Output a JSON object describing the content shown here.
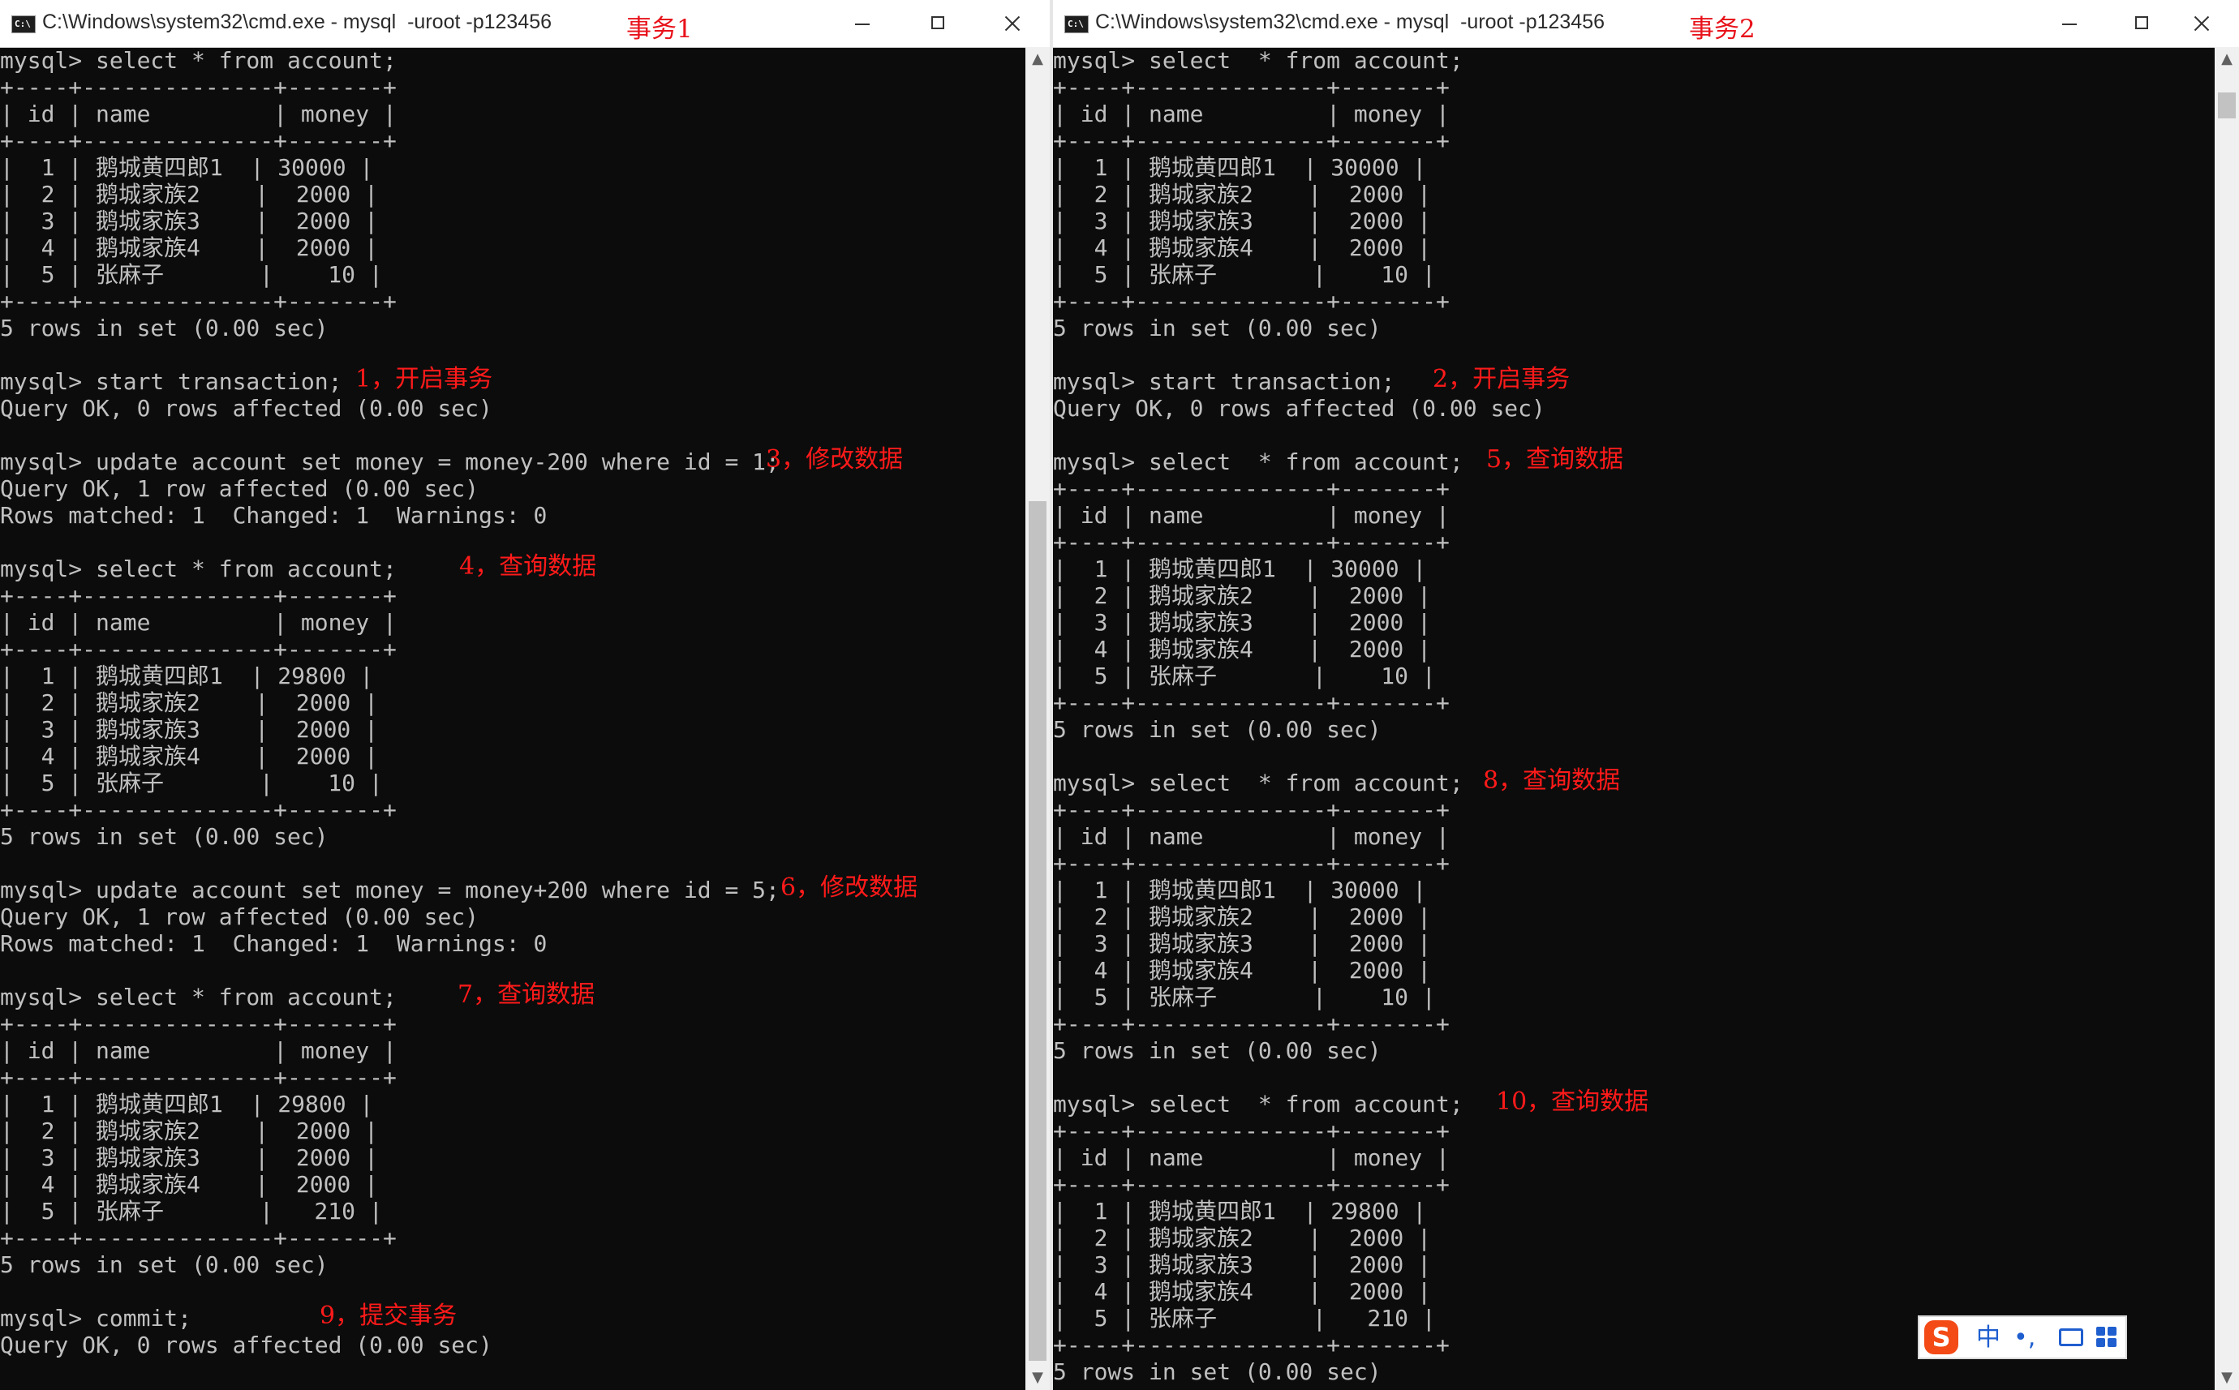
{
  "window1": {
    "title": "C:\\Windows\\system32\\cmd.exe - mysql  -uroot -p123456",
    "label": "事务1",
    "lines": [
      "mysql> select * from account;",
      "+----+--------------+-------+",
      "| id | name         | money |",
      "+----+--------------+-------+",
      "|  1 | 鹅城黄四郎1  | 30000 |",
      "|  2 | 鹅城家族2    |  2000 |",
      "|  3 | 鹅城家族3    |  2000 |",
      "|  4 | 鹅城家族4    |  2000 |",
      "|  5 | 张麻子       |    10 |",
      "+----+--------------+-------+",
      "5 rows in set (0.00 sec)",
      "",
      "mysql> start transaction;",
      "Query OK, 0 rows affected (0.00 sec)",
      "",
      "mysql> update account set money = money-200 where id = 1;",
      "Query OK, 1 row affected (0.00 sec)",
      "Rows matched: 1  Changed: 1  Warnings: 0",
      "",
      "mysql> select * from account;",
      "+----+--------------+-------+",
      "| id | name         | money |",
      "+----+--------------+-------+",
      "|  1 | 鹅城黄四郎1  | 29800 |",
      "|  2 | 鹅城家族2    |  2000 |",
      "|  3 | 鹅城家族3    |  2000 |",
      "|  4 | 鹅城家族4    |  2000 |",
      "|  5 | 张麻子       |    10 |",
      "+----+--------------+-------+",
      "5 rows in set (0.00 sec)",
      "",
      "mysql> update account set money = money+200 where id = 5;",
      "Query OK, 1 row affected (0.00 sec)",
      "Rows matched: 1  Changed: 1  Warnings: 0",
      "",
      "mysql> select * from account;",
      "+----+--------------+-------+",
      "| id | name         | money |",
      "+----+--------------+-------+",
      "|  1 | 鹅城黄四郎1  | 29800 |",
      "|  2 | 鹅城家族2    |  2000 |",
      "|  3 | 鹅城家族3    |  2000 |",
      "|  4 | 鹅城家族4    |  2000 |",
      "|  5 | 张麻子       |   210 |",
      "+----+--------------+-------+",
      "5 rows in set (0.00 sec)",
      "",
      "mysql> commit;",
      "Query OK, 0 rows affected (0.00 sec)"
    ],
    "notes": [
      {
        "line": 12,
        "text": "1，开启事务"
      },
      {
        "line": 15,
        "text": "3，修改数据"
      },
      {
        "line": 19,
        "text": "4，查询数据"
      },
      {
        "line": 31,
        "text": "6，修改数据"
      },
      {
        "line": 35,
        "text": "7，查询数据"
      },
      {
        "line": 47,
        "text": "9，提交事务"
      }
    ]
  },
  "window2": {
    "title": "C:\\Windows\\system32\\cmd.exe - mysql  -uroot -p123456",
    "label": "事务2",
    "lines": [
      "mysql> select  * from account;",
      "+----+--------------+-------+",
      "| id | name         | money |",
      "+----+--------------+-------+",
      "|  1 | 鹅城黄四郎1  | 30000 |",
      "|  2 | 鹅城家族2    |  2000 |",
      "|  3 | 鹅城家族3    |  2000 |",
      "|  4 | 鹅城家族4    |  2000 |",
      "|  5 | 张麻子       |    10 |",
      "+----+--------------+-------+",
      "5 rows in set (0.00 sec)",
      "",
      "mysql> start transaction;",
      "Query OK, 0 rows affected (0.00 sec)",
      "",
      "mysql> select  * from account;",
      "+----+--------------+-------+",
      "| id | name         | money |",
      "+----+--------------+-------+",
      "|  1 | 鹅城黄四郎1  | 30000 |",
      "|  2 | 鹅城家族2    |  2000 |",
      "|  3 | 鹅城家族3    |  2000 |",
      "|  4 | 鹅城家族4    |  2000 |",
      "|  5 | 张麻子       |    10 |",
      "+----+--------------+-------+",
      "5 rows in set (0.00 sec)",
      "",
      "mysql> select  * from account;",
      "+----+--------------+-------+",
      "| id | name         | money |",
      "+----+--------------+-------+",
      "|  1 | 鹅城黄四郎1  | 30000 |",
      "|  2 | 鹅城家族2    |  2000 |",
      "|  3 | 鹅城家族3    |  2000 |",
      "|  4 | 鹅城家族4    |  2000 |",
      "|  5 | 张麻子       |    10 |",
      "+----+--------------+-------+",
      "5 rows in set (0.00 sec)",
      "",
      "mysql> select  * from account;",
      "+----+--------------+-------+",
      "| id | name         | money |",
      "+----+--------------+-------+",
      "|  1 | 鹅城黄四郎1  | 29800 |",
      "|  2 | 鹅城家族2    |  2000 |",
      "|  3 | 鹅城家族3    |  2000 |",
      "|  4 | 鹅城家族4    |  2000 |",
      "|  5 | 张麻子       |   210 |",
      "+----+--------------+-------+",
      "5 rows in set (0.00 sec)"
    ],
    "notes": [
      {
        "line": 12,
        "text": "2，开启事务"
      },
      {
        "line": 15,
        "text": "5，查询数据"
      },
      {
        "line": 27,
        "text": "8，查询数据"
      },
      {
        "line": 39,
        "text": "10，查询数据"
      }
    ]
  },
  "ime": {
    "logo": "S",
    "mode": "中",
    "punct": "•,"
  },
  "icons": {
    "window": "cmd-icon",
    "minimize": "minimize-icon",
    "maximize": "maximize-icon",
    "close": "close-icon"
  },
  "colors": {
    "console_bg": "#0c0c0c",
    "console_text": "#c0c0c0",
    "annotation": "#ff1a1a"
  }
}
